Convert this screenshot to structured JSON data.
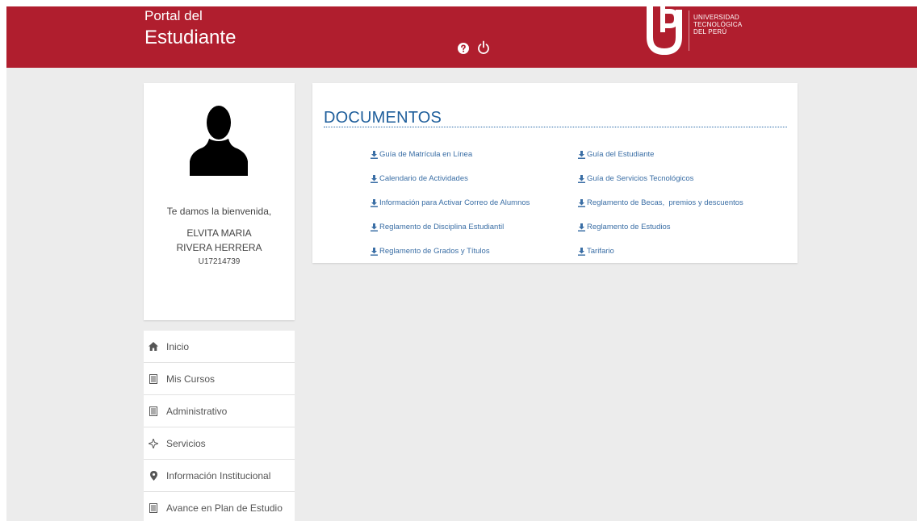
{
  "header": {
    "portal_line1": "Portal del",
    "portal_line2": "Estudiante",
    "help_icon": "question-circle-icon",
    "power_icon": "power-icon",
    "logo_lines": [
      "UNIVERSIDAD",
      "TECNOLÓGICA",
      "DEL PERÚ"
    ]
  },
  "profile": {
    "welcome": "Te damos la bienvenida,",
    "name_line1": "ELVITA MARIA",
    "name_line2": "RIVERA HERRERA",
    "code": "U17214739"
  },
  "menu": {
    "items": [
      {
        "label": "Inicio",
        "icon": "home-icon"
      },
      {
        "label": "Mis Cursos",
        "icon": "list-icon"
      },
      {
        "label": "Administrativo",
        "icon": "list-icon"
      },
      {
        "label": "Servicios",
        "icon": "services-icon"
      },
      {
        "label": "Información Institucional",
        "icon": "map-marker-icon"
      },
      {
        "label": "Avance en Plan de Estudio",
        "icon": "list-icon"
      }
    ]
  },
  "documents": {
    "title": "DOCUMENTOS",
    "left": [
      "Guía de Matrícula en Línea",
      "Calendario de Actividades",
      "Información para Activar Correo de Alumnos",
      "Reglamento de Disciplina Estudiantil",
      "Reglamento de Grados y Títulos"
    ],
    "right": [
      "Guía del Estudiante",
      "Guía de Servicios Tecnológicos",
      "Reglamento de Becas,  premios y descuentos",
      "Reglamento de Estudios",
      "Tarifario"
    ]
  },
  "colors": {
    "header_red": "#b01e2e",
    "link_blue": "#3a6ea5",
    "title_blue": "#1e5e9b",
    "background": "#ececec"
  }
}
